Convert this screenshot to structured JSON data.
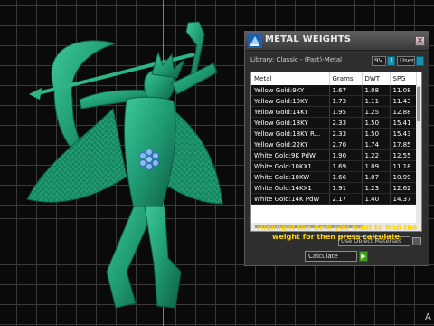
{
  "window": {
    "title": "METAL WEIGHTS",
    "close_glyph": "×"
  },
  "library": {
    "label": "Library: Classic - (Fast)-Metal",
    "unit_value": "9V",
    "unit_user": "User"
  },
  "table": {
    "columns": [
      "Metal",
      "Grams",
      "DWT",
      "SPG"
    ],
    "rows": [
      [
        "Yellow Gold:9KY",
        "1.67",
        "1.08",
        "11.08"
      ],
      [
        "Yellow Gold:10KY",
        "1.73",
        "1.11",
        "11.43"
      ],
      [
        "Yellow Gold:14KY",
        "1.95",
        "1.25",
        "12.88"
      ],
      [
        "Yellow Gold:18KY",
        "2.33",
        "1.50",
        "15.41"
      ],
      [
        "Yellow Gold:18KY R...",
        "2.33",
        "1.50",
        "15.43"
      ],
      [
        "Yellow Gold:22KY",
        "2.70",
        "1.74",
        "17.85"
      ],
      [
        "White Gold:9K PdW",
        "1.90",
        "1.22",
        "12.55"
      ],
      [
        "White Gold:10KX1",
        "1.69",
        "1.09",
        "11.18"
      ],
      [
        "White Gold:10KW",
        "1.66",
        "1.07",
        "10.99"
      ],
      [
        "White Gold:14KX1",
        "1.91",
        "1.23",
        "12.62"
      ],
      [
        "White Gold:14K PdW",
        "2.17",
        "1.40",
        "14.37"
      ]
    ]
  },
  "options": {
    "use_object_materials": "Use Object Materials"
  },
  "instructions": "Highlight the item you want to find the weight for then press calculate.",
  "calculate": {
    "value": "Calculate",
    "go_glyph": "▶"
  },
  "corner_text": "A",
  "colors": {
    "model": "#1f9a72",
    "gem": "#8fb8ff",
    "axis_y": "#1da4c4",
    "instructions": "#ffd400",
    "go_button": "#3fa31c"
  }
}
